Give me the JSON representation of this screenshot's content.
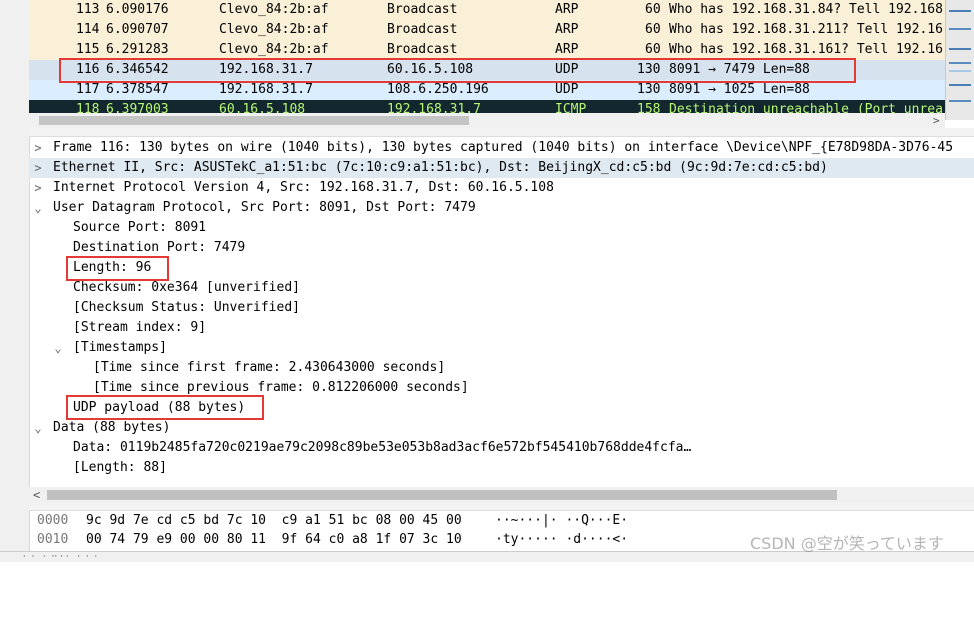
{
  "colors": {
    "arp_bg": "#faf0d7",
    "selected_bg": "#d6e2ee",
    "udp_bg": "#daeeff",
    "icmp_bg": "#12272e",
    "icmp_fg": "#b7f774",
    "highlight_red": "#e53935",
    "ethernet_line_bg": "#dfe9f2"
  },
  "packets": [
    {
      "no": "113",
      "time": "6.090176",
      "src": "Clevo_84:2b:af",
      "dst": "Broadcast",
      "proto": "ARP",
      "len": "60",
      "info": "Who has 192.168.31.84? Tell 192.168"
    },
    {
      "no": "114",
      "time": "6.090707",
      "src": "Clevo_84:2b:af",
      "dst": "Broadcast",
      "proto": "ARP",
      "len": "60",
      "info": "Who has 192.168.31.211? Tell 192.16"
    },
    {
      "no": "115",
      "time": "6.291283",
      "src": "Clevo_84:2b:af",
      "dst": "Broadcast",
      "proto": "ARP",
      "len": "60",
      "info": "Who has 192.168.31.161? Tell 192.16"
    },
    {
      "no": "116",
      "time": "6.346542",
      "src": "192.168.31.7",
      "dst": "60.16.5.108",
      "proto": "UDP",
      "len": "130",
      "info": "8091 → 7479 Len=88"
    },
    {
      "no": "117",
      "time": "6.378547",
      "src": "192.168.31.7",
      "dst": "108.6.250.196",
      "proto": "UDP",
      "len": "130",
      "info": "8091 → 1025 Len=88"
    },
    {
      "no": "118",
      "time": "6.397003",
      "src": "60.16.5.108",
      "dst": "192.168.31.7",
      "proto": "ICMP",
      "len": "158",
      "info": "Destination unreachable (Port unrea"
    }
  ],
  "details": {
    "frame": "Frame 116: 130 bytes on wire (1040 bits), 130 bytes captured (1040 bits) on interface \\Device\\NPF_{E78D98DA-3D76-45",
    "ethernet": "Ethernet II, Src: ASUSTekC_a1:51:bc (7c:10:c9:a1:51:bc), Dst: BeijingX_cd:c5:bd (9c:9d:7e:cd:c5:bd)",
    "ip": "Internet Protocol Version 4, Src: 192.168.31.7, Dst: 60.16.5.108",
    "udp": "User Datagram Protocol, Src Port: 8091, Dst Port: 7479",
    "src_port": "Source Port: 8091",
    "dst_port": "Destination Port: 7479",
    "length": "Length: 96",
    "checksum": "Checksum: 0xe364 [unverified]",
    "checksum_status": "[Checksum Status: Unverified]",
    "stream_index": "[Stream index: 9]",
    "timestamps": "[Timestamps]",
    "ts_first": "[Time since first frame: 2.430643000 seconds]",
    "ts_prev": "[Time since previous frame: 0.812206000 seconds]",
    "payload": "UDP payload (88 bytes)",
    "data": "Data (88 bytes)",
    "data_hex": "Data: 0119b2485fa720c0219ae79c2098c89be53e053b8ad3acf6e572bf545410b768dde4fcfa…",
    "data_len": "[Length: 88]"
  },
  "bytes": [
    {
      "offset": "0000",
      "hex": "9c 9d 7e cd c5 bd 7c 10  c9 a1 51 bc 08 00 45 00",
      "ascii": "··~···|· ··Q···E·"
    },
    {
      "offset": "0010",
      "hex": "00 74 79 e9 00 00 80 11  9f 64 c0 a8 1f 07 3c 10",
      "ascii": "·ty····· ·d····<·"
    }
  ],
  "status": "        ·  ·   ·  ·· · ·   ·  ·  ·",
  "watermark": "CSDN @空が笑っています",
  "icons": {
    "collapsed": "chevron-right-icon",
    "expanded": "chevron-down-icon",
    "scroll_left": "arrow-left-icon",
    "scroll_right": "arrow-right-icon"
  }
}
